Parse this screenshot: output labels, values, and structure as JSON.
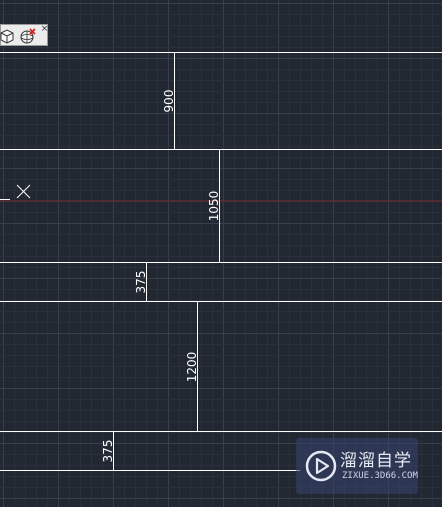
{
  "app": {
    "name": "AutoCAD drawing canvas"
  },
  "colors": {
    "background": "#222831",
    "grid_minor": "#2a313c",
    "grid_major": "#36404c",
    "entity": "#ffffff",
    "axis_x": "#7a2a2e"
  },
  "toolbar": {
    "buttons": [
      {
        "icon": "cube-view-icon"
      },
      {
        "icon": "orbit-close-icon"
      }
    ],
    "close_label": "×"
  },
  "drawing": {
    "dimensions": [
      {
        "value": "900"
      },
      {
        "value": "1050"
      },
      {
        "value": "375"
      },
      {
        "value": "1200"
      },
      {
        "value": "375"
      }
    ]
  },
  "watermark": {
    "brand": "溜溜自学",
    "site": "ZIXUE.3D66.COM"
  }
}
